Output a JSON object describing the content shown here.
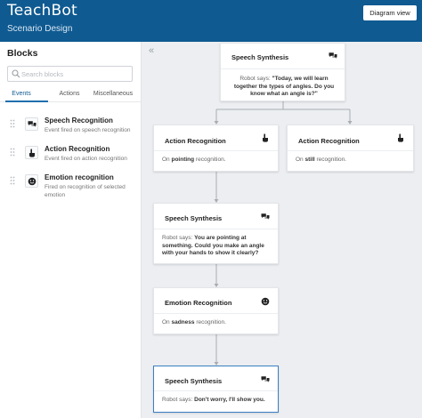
{
  "app": {
    "brand": "TeachBot",
    "subtitle": "Scenario Design",
    "diagram_button": "Diagram view"
  },
  "sidebar": {
    "title": "Blocks",
    "search_placeholder": "Search blocks",
    "tabs": [
      {
        "label": "Events",
        "active": true
      },
      {
        "label": "Actions",
        "active": false
      },
      {
        "label": "Miscellaneous",
        "active": false
      }
    ],
    "items": [
      {
        "title": "Speech Recognition",
        "description": "Event fired on speech recognition",
        "icon": "speech-bubble-icon"
      },
      {
        "title": "Action Recognition",
        "description": "Event fired on action recognition",
        "icon": "pointing-hand-icon"
      },
      {
        "title": "Emotion recognition",
        "description": "Fired on recognition of selected emotion",
        "icon": "emotion-face-icon"
      }
    ]
  },
  "collapse_label": "«",
  "diagram": {
    "nodes": [
      {
        "title": "Speech Synthesis",
        "icon": "speech-bubble-icon",
        "prefix": "Robot says: ",
        "strong": "\"Today, we will learn together the types of angles. Do you know what an angle is?\"",
        "suffix": ""
      },
      {
        "title": "Action Recognition",
        "icon": "pointing-hand-icon",
        "prefix": "On ",
        "strong": "pointing",
        "suffix": " recognition."
      },
      {
        "title": "Action Recognition",
        "icon": "pointing-hand-icon",
        "prefix": "On ",
        "strong": "still",
        "suffix": " recognition."
      },
      {
        "title": "Speech Synthesis",
        "icon": "speech-bubble-icon",
        "prefix": "Robot says: ",
        "strong": "You are pointing at something. Could you make an angle with your hands to show it clearly?",
        "suffix": ""
      },
      {
        "title": "Emotion Recognition",
        "icon": "emotion-face-icon",
        "prefix": "On ",
        "strong": "sadness",
        "suffix": " recognition."
      },
      {
        "title": "Speech Synthesis",
        "icon": "speech-bubble-icon",
        "prefix": "Robot says: ",
        "strong": "Don't worry, I'll show you.",
        "suffix": "",
        "selected": true
      }
    ]
  },
  "colors": {
    "header": "#0f5a91",
    "accent": "#1f6fb0",
    "selected_border": "#3a7fc4",
    "canvas": "#eceef1"
  }
}
